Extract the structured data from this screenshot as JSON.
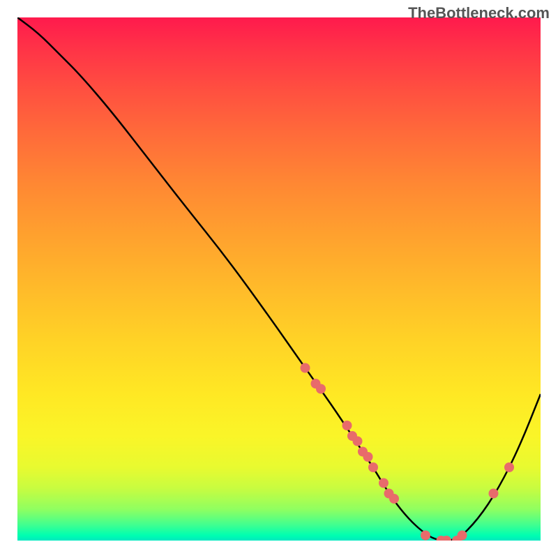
{
  "watermark": "TheBottleneck.com",
  "chart_data": {
    "type": "line",
    "title": "",
    "xlabel": "",
    "ylabel": "",
    "xlim": [
      0,
      100
    ],
    "ylim": [
      0,
      100
    ],
    "grid": false,
    "series": [
      {
        "name": "curve",
        "x": [
          0,
          4,
          8,
          12,
          18,
          25,
          32,
          40,
          48,
          55,
          60,
          64,
          68,
          71,
          74,
          77,
          80,
          84,
          88,
          92,
          96,
          100
        ],
        "values": [
          100,
          97,
          93,
          89,
          82,
          73,
          64,
          54,
          43,
          33,
          26,
          20,
          14,
          9,
          5,
          2,
          0,
          0,
          4,
          10,
          18,
          28
        ]
      }
    ],
    "markers": {
      "name": "highlighted-points",
      "color": "#e86b6b",
      "x": [
        55,
        57,
        58,
        63,
        64,
        65,
        66,
        67,
        68,
        70,
        71,
        72,
        78,
        81,
        82,
        84,
        85,
        91,
        94
      ],
      "values": [
        33,
        30,
        29,
        22,
        20,
        19,
        17,
        16,
        14,
        11,
        9,
        8,
        1,
        0,
        0,
        0,
        1,
        9,
        14
      ]
    },
    "background_gradient": {
      "top": "#ff1a4d",
      "upper_mid": "#ffbb2a",
      "lower_mid": "#faf528",
      "bottom": "#00e8c0"
    }
  }
}
